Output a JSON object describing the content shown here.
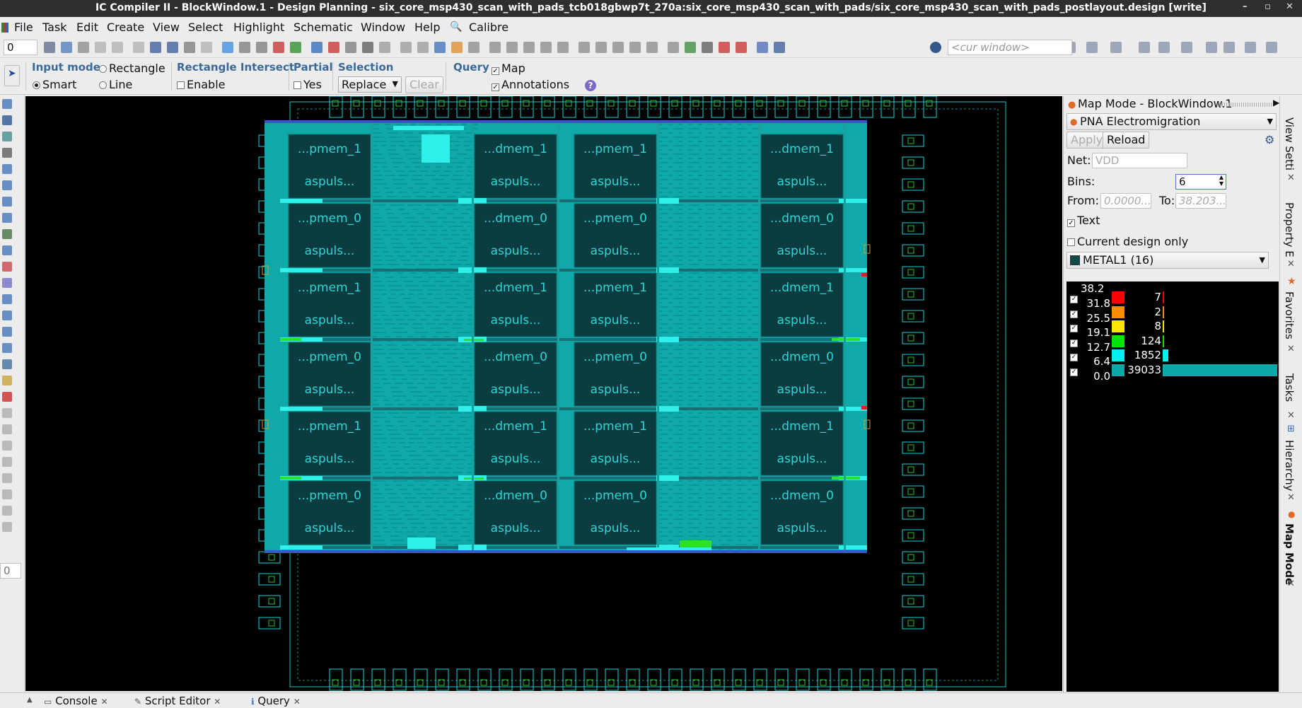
{
  "window": {
    "title": "IC Compiler II - BlockWindow.1 - Design Planning - six_core_msp430_scan_with_pads_tcb018gbwp7t_270a:six_core_msp430_scan_with_pads/six_core_msp430_scan_with_pads_postlayout.design [write]",
    "min": "–",
    "max": "▫",
    "close": "✕"
  },
  "menu": [
    "File",
    "Task",
    "Edit",
    "Create",
    "View",
    "Select",
    "Highlight",
    "Schematic",
    "Window",
    "Help",
    "Calibre"
  ],
  "toolbar": {
    "spin_value": "0",
    "cur_window_placeholder": "<cur window>"
  },
  "options": {
    "input_mode": {
      "title": "Input mode",
      "rectangle": "Rectangle",
      "smart": "Smart",
      "line": "Line",
      "selected": "Smart"
    },
    "rect_intersect": {
      "title": "Rectangle Intersect",
      "enable": "Enable",
      "checked": false
    },
    "partial": {
      "title": "Partial",
      "yes": "Yes",
      "checked": false
    },
    "selection": {
      "title": "Selection",
      "value": "Replace",
      "clear": "Clear"
    },
    "query": {
      "title": "Query",
      "map": "Map",
      "annotations": "Annotations",
      "map_checked": true,
      "annotations_checked": true
    }
  },
  "left_spin": "0",
  "layout": {
    "blocks": [
      [
        "...pmem_1",
        "...dmem_1",
        "...pmem_1",
        "...dmem_1"
      ],
      [
        "...pmem_0",
        "...dmem_0",
        "...pmem_0",
        "...dmem_0"
      ],
      [
        "...pmem_1",
        "...dmem_1",
        "...pmem_1",
        "...dmem_1"
      ],
      [
        "...pmem_0",
        "...dmem_0",
        "...pmem_0",
        "...dmem_0"
      ],
      [
        "...pmem_1",
        "...dmem_1",
        "...pmem_1",
        "...dmem_1"
      ],
      [
        "...pmem_0",
        "...dmem_0",
        "...pmem_0",
        "...dmem_0"
      ]
    ],
    "sublabel": "aspuls...",
    "colors": {
      "fill": "#0fa9a9",
      "block": "#0b3d40",
      "outline": "#1cc6c6",
      "hot": "#2ff0e8",
      "green": "#2ee02e",
      "pad": "#19d3d3"
    }
  },
  "panel": {
    "title": "Map Mode - BlockWindow.1",
    "map": "PNA Electromigration",
    "apply": "Apply",
    "reload": "Reload",
    "net_label": "Net:",
    "net_placeholder": "VDD",
    "bins_label": "Bins:",
    "bins_value": "6",
    "from_label": "From:",
    "from_value": "0.0000...",
    "to_label": "To:",
    "to_value": "38.203...",
    "text_label": "Text",
    "text_checked": true,
    "current_only_label": "Current design only",
    "current_only_checked": false,
    "layer": "METAL1 (16)",
    "histogram": [
      {
        "upper": "38.2",
        "lower": "31.8",
        "count": "7",
        "count_value": 7,
        "color": "#ff0000"
      },
      {
        "upper": "31.8",
        "lower": "25.5",
        "count": "2",
        "count_value": 2,
        "color": "#ff8c00"
      },
      {
        "upper": "25.5",
        "lower": "19.1",
        "count": "8",
        "count_value": 8,
        "color": "#ffe600"
      },
      {
        "upper": "19.1",
        "lower": "12.7",
        "count": "124",
        "count_value": 124,
        "color": "#00e600"
      },
      {
        "upper": "12.7",
        "lower": "6.4",
        "count": "1852",
        "count_value": 1852,
        "color": "#00f0f0"
      },
      {
        "upper": "6.4",
        "lower": "0.0",
        "count": "39033",
        "count_value": 39033,
        "color": "#0aa8a8"
      }
    ]
  },
  "side_tabs": [
    "View Setti",
    "Property E",
    "Favorites",
    "Tasks",
    "Hierarchy",
    "Map Mode"
  ],
  "bottom_tabs": [
    "Console",
    "Script Editor",
    "Query"
  ]
}
